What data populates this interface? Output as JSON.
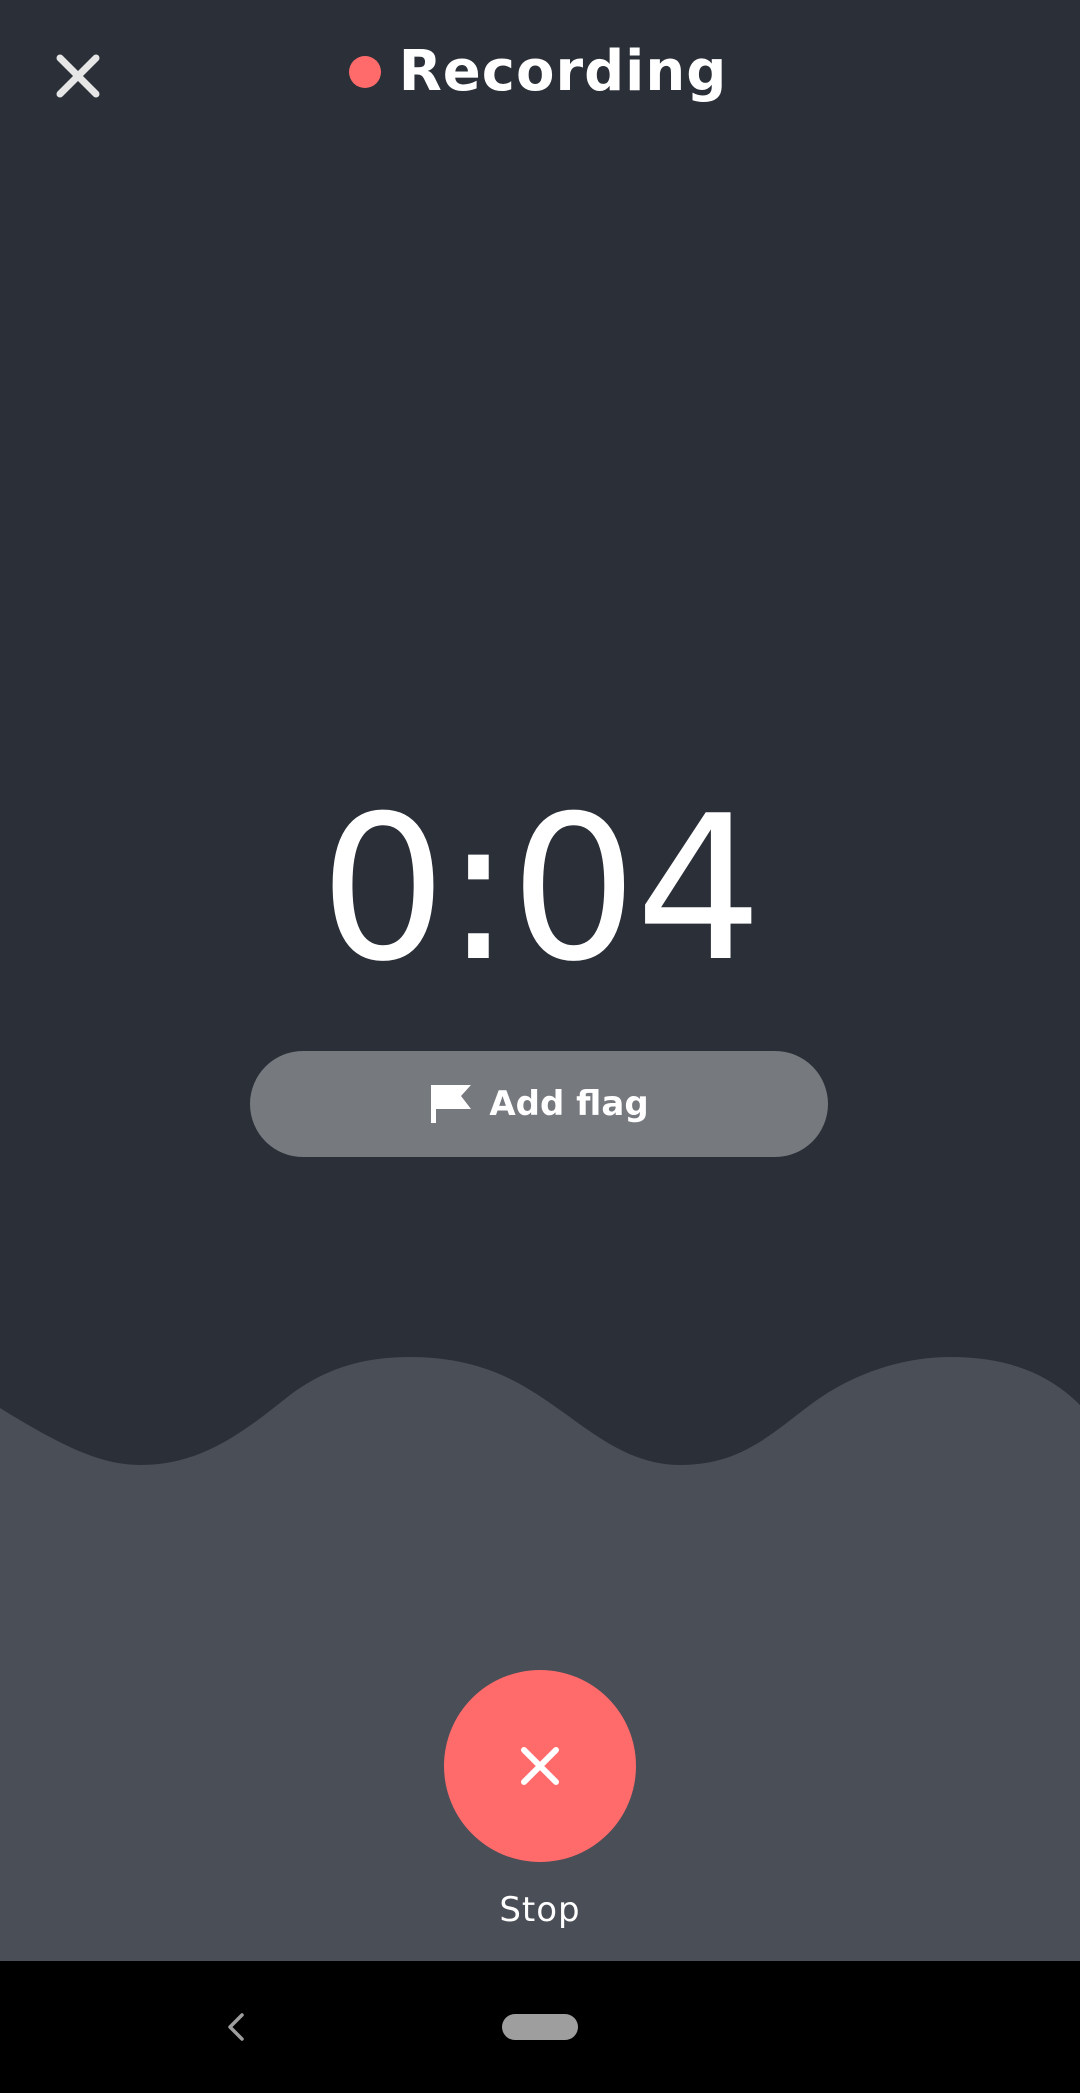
{
  "header": {
    "close_icon": "close-icon",
    "recording_indicator_color": "#ff6b6b",
    "title": "Recording"
  },
  "timer": {
    "elapsed": "0:04"
  },
  "flag_button": {
    "icon": "flag-icon",
    "label": "Add flag"
  },
  "stop_button": {
    "icon": "close-icon",
    "label": "Stop",
    "color": "#ff6b6b"
  },
  "system_nav": {
    "back_icon": "chevron-left-icon",
    "home_icon": "home-pill-icon"
  },
  "colors": {
    "background": "#2a2f38",
    "wave": "#4a4e57",
    "flag_button_bg": "#76797e",
    "nav_bar": "#000000"
  }
}
